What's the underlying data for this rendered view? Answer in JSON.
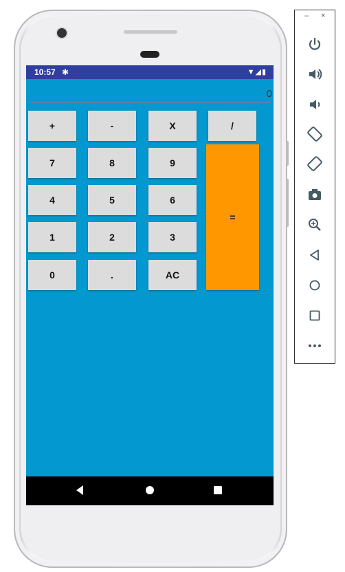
{
  "status_bar": {
    "time": "10:57"
  },
  "display": {
    "value": "0"
  },
  "keys": {
    "plus": "+",
    "minus": "-",
    "multiply": "X",
    "divide": "/",
    "seven": "7",
    "eight": "8",
    "nine": "9",
    "four": "4",
    "five": "5",
    "six": "6",
    "one": "1",
    "two": "2",
    "three": "3",
    "zero": "0",
    "dot": ".",
    "clear": "AC",
    "equals": "="
  },
  "colors": {
    "screen_bg": "#0398cf",
    "status_bar": "#303f9f",
    "key_bg": "#dcdcdc",
    "equals_bg": "#ff9800",
    "display_underline": "#e35b7a"
  },
  "emulator_panel": {
    "window_controls": [
      "minimize-icon",
      "close-icon"
    ],
    "tools": [
      "power-icon",
      "volume-up-icon",
      "volume-down-icon",
      "rotate-left-icon",
      "rotate-right-icon",
      "camera-icon",
      "zoom-icon",
      "back-icon",
      "home-icon",
      "overview-icon",
      "more-icon"
    ]
  }
}
